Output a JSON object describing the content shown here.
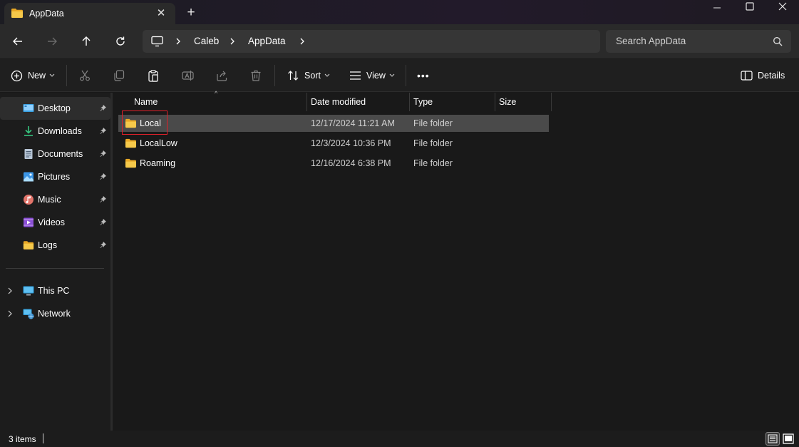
{
  "window": {
    "tab_title": "AppData",
    "new_tab_symbol": "+",
    "close_tab_symbol": "✕"
  },
  "address_bar": {
    "crumbs": [
      "Caleb",
      "AppData"
    ],
    "search_placeholder": "Search AppData"
  },
  "command_bar": {
    "new_label": "New",
    "sort_label": "Sort",
    "view_label": "View",
    "more_label": "•••",
    "details_label": "Details"
  },
  "sidebar": {
    "quick_access": [
      {
        "label": "Desktop",
        "icon": "desktop-icon",
        "pinned": true,
        "active": true
      },
      {
        "label": "Downloads",
        "icon": "downloads-icon",
        "pinned": true
      },
      {
        "label": "Documents",
        "icon": "documents-icon",
        "pinned": true
      },
      {
        "label": "Pictures",
        "icon": "pictures-icon",
        "pinned": true
      },
      {
        "label": "Music",
        "icon": "music-icon",
        "pinned": true
      },
      {
        "label": "Videos",
        "icon": "videos-icon",
        "pinned": true
      },
      {
        "label": "Logs",
        "icon": "folder-icon",
        "pinned": true
      }
    ],
    "locations": [
      {
        "label": "This PC",
        "icon": "this-pc-icon"
      },
      {
        "label": "Network",
        "icon": "network-icon"
      }
    ]
  },
  "file_list": {
    "columns": [
      "Name",
      "Date modified",
      "Type",
      "Size"
    ],
    "rows": [
      {
        "name": "Local",
        "date": "12/17/2024 11:21 AM",
        "type": "File folder",
        "size": "",
        "selected": true
      },
      {
        "name": "LocalLow",
        "date": "12/3/2024 10:36 PM",
        "type": "File folder",
        "size": ""
      },
      {
        "name": "Roaming",
        "date": "12/16/2024 6:38 PM",
        "type": "File folder",
        "size": ""
      }
    ]
  },
  "status_bar": {
    "item_count": "3 items"
  },
  "colors": {
    "folder_yellow": "#f4c542",
    "selection": "#4a4a4a",
    "highlight_border": "#e0202a"
  }
}
